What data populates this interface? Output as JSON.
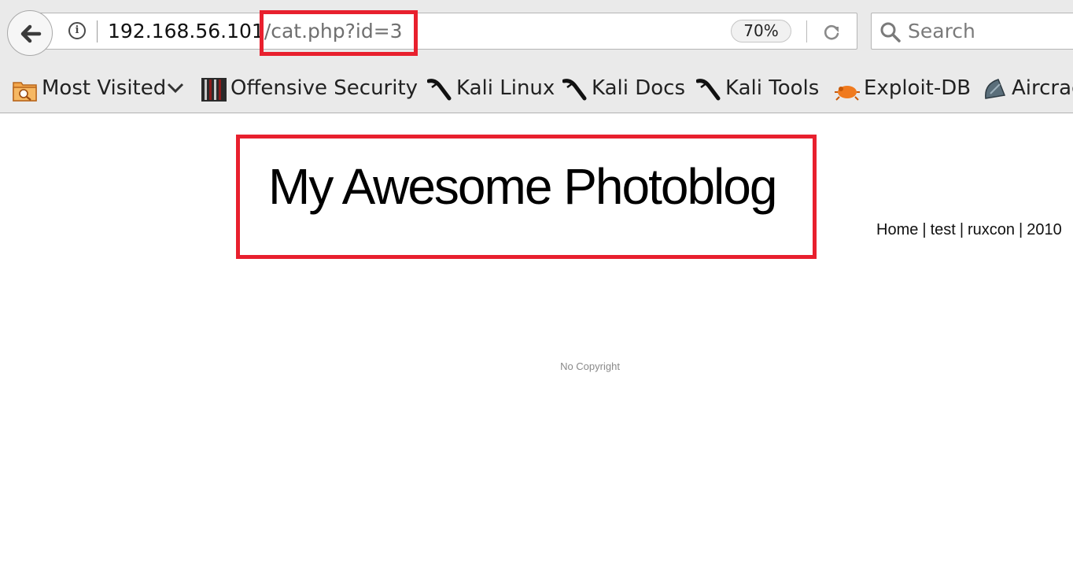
{
  "navbar": {
    "url_host": "192.168.56.101",
    "url_path": "/cat.php?id=3",
    "zoom": "70%",
    "search_placeholder": "Search"
  },
  "bookmarks": [
    {
      "label": "Most Visited",
      "icon": "most-visited-folder-icon"
    },
    {
      "label": "Offensive Security",
      "icon": "offensive-security-icon"
    },
    {
      "label": "Kali Linux",
      "icon": "kali-dragon-icon"
    },
    {
      "label": "Kali Docs",
      "icon": "kali-dragon-icon"
    },
    {
      "label": "Kali Tools",
      "icon": "kali-dragon-icon"
    },
    {
      "label": "Exploit-DB",
      "icon": "exploit-db-bug-icon"
    },
    {
      "label": "Aircrack-ng",
      "icon": "aircrack-satellite-icon"
    }
  ],
  "page": {
    "title": "My Awesome Photoblog",
    "nav": [
      "Home",
      "test",
      "ruxcon",
      "2010"
    ],
    "footer": "No Copyright"
  },
  "colors": {
    "highlight": "#e8202e",
    "chrome": "#eaeaea",
    "url_path": "#6f6f6f"
  }
}
